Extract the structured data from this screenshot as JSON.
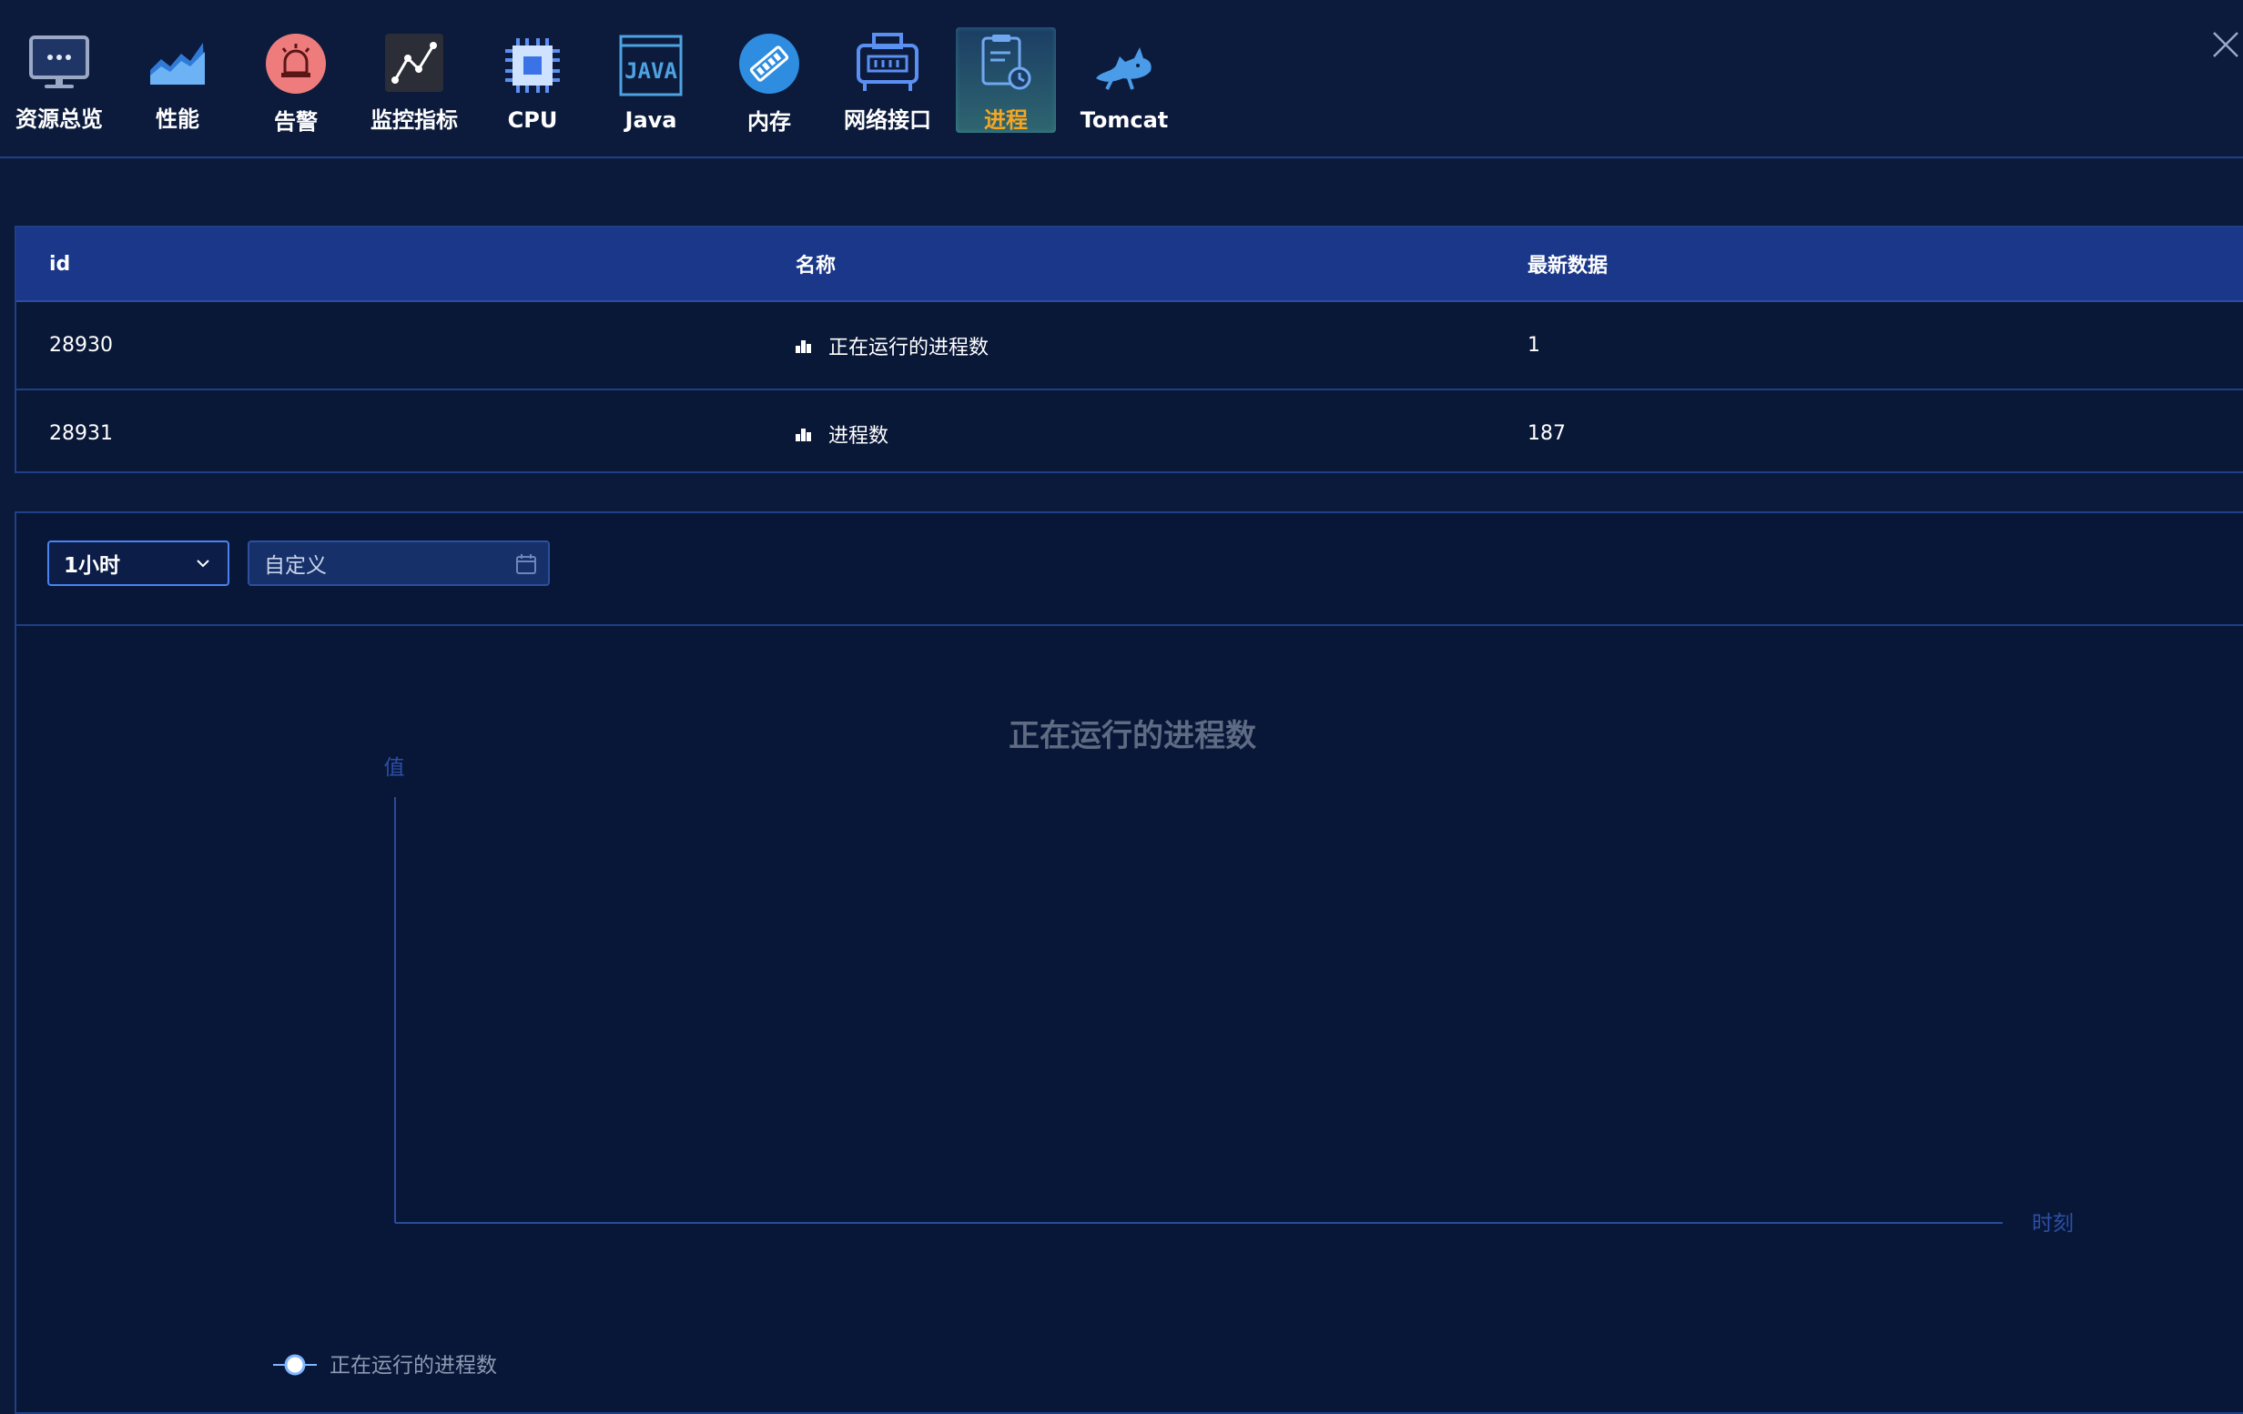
{
  "nav": {
    "items": [
      {
        "label": "资源总览",
        "icon": "monitor-icon"
      },
      {
        "label": "性能",
        "icon": "area-chart-icon"
      },
      {
        "label": "告警",
        "icon": "alarm-icon"
      },
      {
        "label": "监控指标",
        "icon": "line-chart-icon"
      },
      {
        "label": "CPU",
        "icon": "cpu-icon"
      },
      {
        "label": "Java",
        "icon": "java-icon"
      },
      {
        "label": "内存",
        "icon": "memory-icon"
      },
      {
        "label": "网络接口",
        "icon": "network-interface-icon"
      },
      {
        "label": "进程",
        "icon": "process-icon",
        "active": true
      },
      {
        "label": "Tomcat",
        "icon": "tomcat-icon"
      }
    ]
  },
  "table": {
    "headers": [
      "id",
      "名称",
      "最新数据"
    ],
    "rows": [
      {
        "id": "28930",
        "name": "正在运行的进程数",
        "latest": "1"
      },
      {
        "id": "28931",
        "name": "进程数",
        "latest": "187"
      }
    ]
  },
  "filters": {
    "range_value": "1小时",
    "custom_placeholder": "自定义"
  },
  "colors": {
    "accent": "#f5a623",
    "header_bg": "#1a378a",
    "border": "#1f3f86",
    "axis": "#2a4b9a"
  },
  "chart_data": {
    "type": "line",
    "title": "正在运行的进程数",
    "ylabel": "值",
    "xlabel": "时刻",
    "series": [
      {
        "name": "正在运行的进程数",
        "values": []
      }
    ],
    "x": [],
    "legend": "bottom-left",
    "grid": false
  }
}
